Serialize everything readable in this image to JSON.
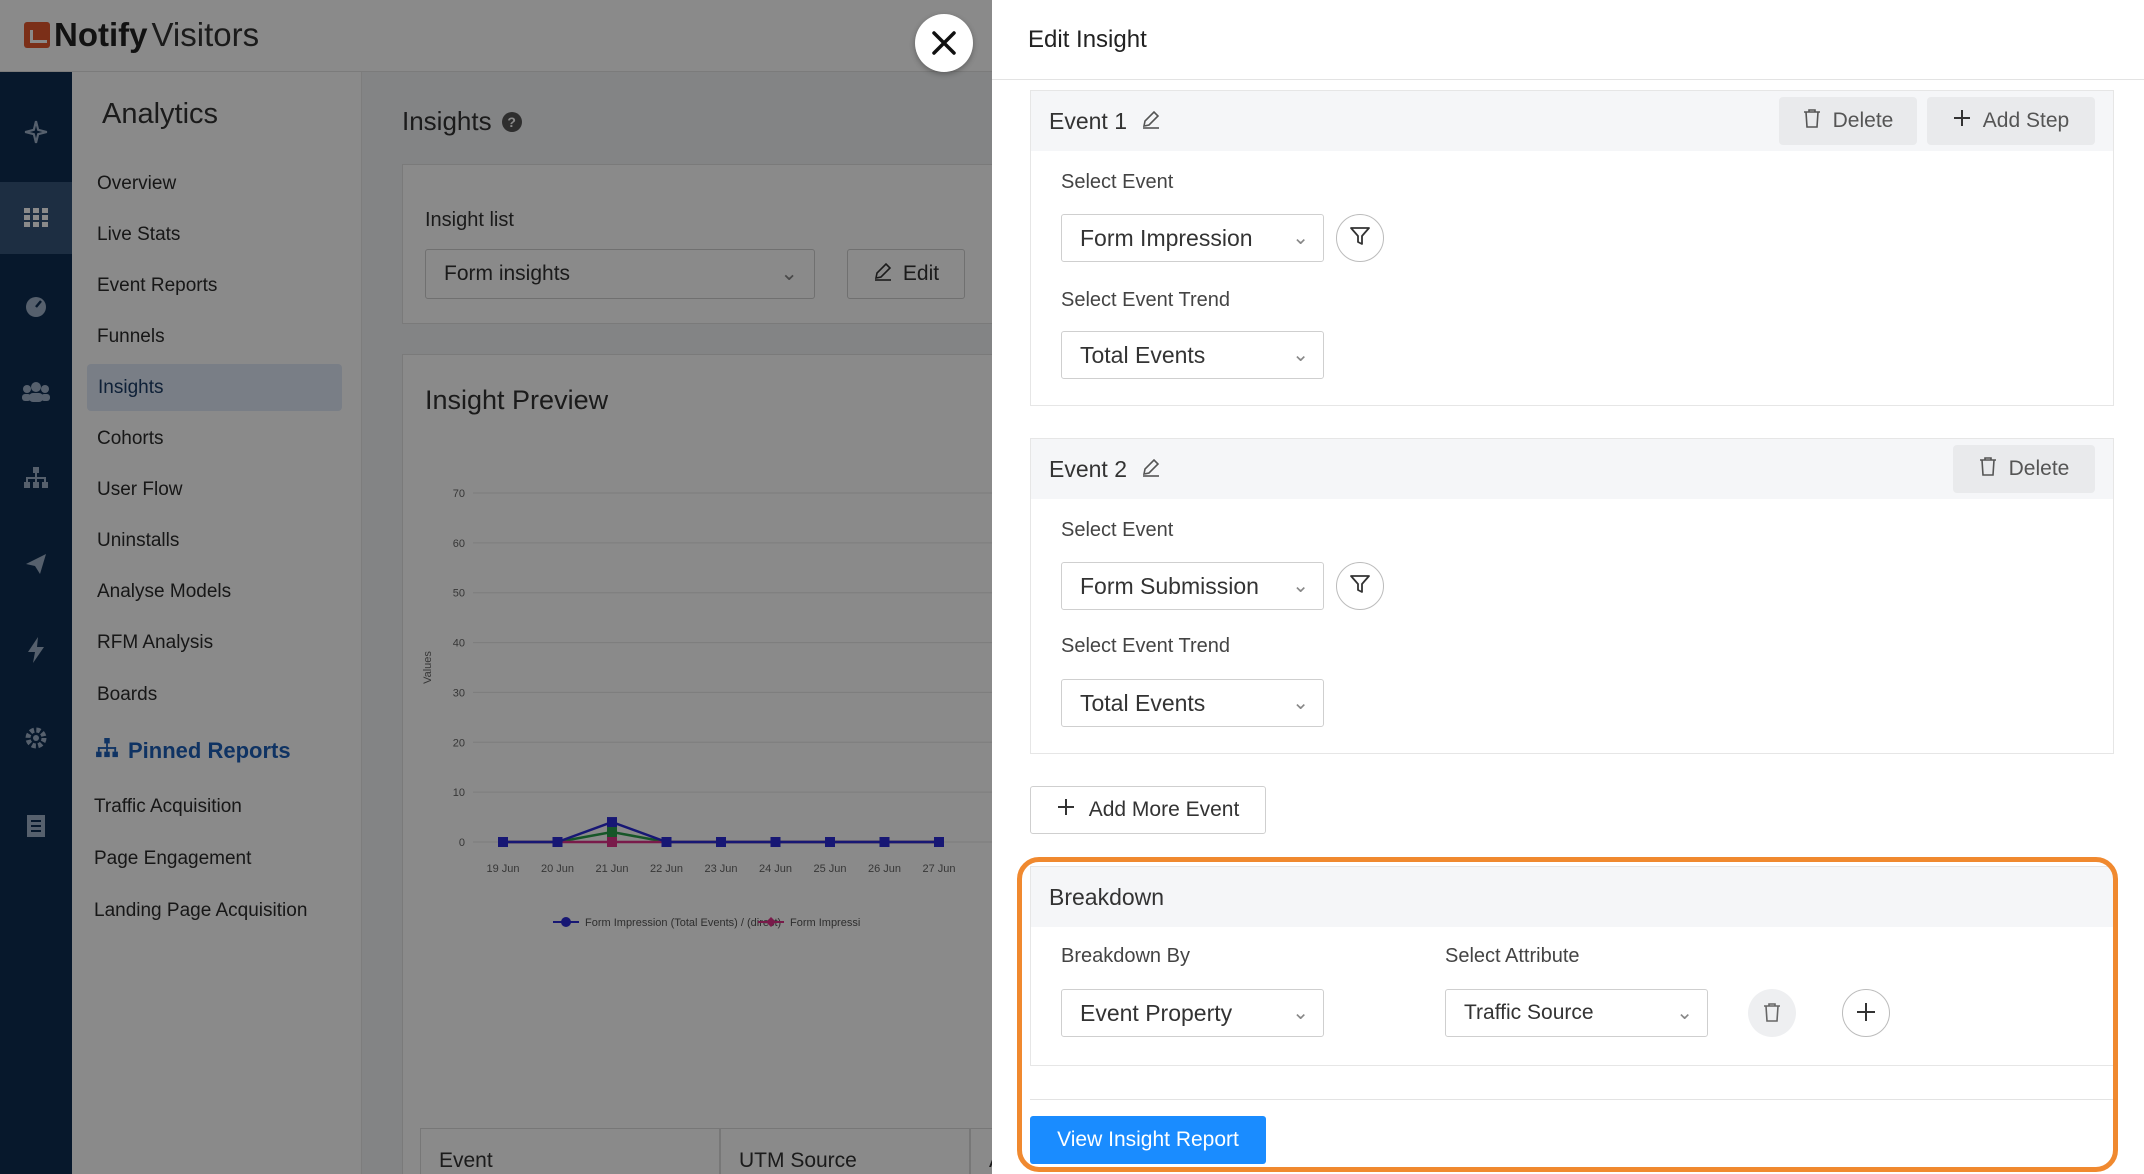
{
  "app": {
    "logo_bold": "Notify",
    "logo_light": "Visitors",
    "nav_title": "Analytics",
    "nav_items": [
      {
        "label": "Overview"
      },
      {
        "label": "Live Stats"
      },
      {
        "label": "Event Reports"
      },
      {
        "label": "Funnels"
      },
      {
        "label": "Insights",
        "active": true
      },
      {
        "label": "Cohorts"
      },
      {
        "label": "User Flow"
      },
      {
        "label": "Uninstalls"
      },
      {
        "label": "Analyse Models"
      },
      {
        "label": "RFM Analysis"
      },
      {
        "label": "Boards"
      }
    ],
    "pinned_title": "Pinned Reports",
    "pinned_items": [
      {
        "label": "Traffic Acquisition"
      },
      {
        "label": "Page Engagement"
      },
      {
        "label": "Landing Page Acquisition"
      }
    ],
    "rail_icons": [
      "sparkle-icon",
      "grid-icon",
      "dashboard-icon",
      "users-icon",
      "sitemap-icon",
      "send-icon",
      "bolt-icon",
      "gear-icon",
      "document-icon"
    ]
  },
  "content": {
    "title": "Insights",
    "insight_list_label": "Insight list",
    "insight_select_value": "Form insights",
    "edit_label": "Edit",
    "preview_title": "Insight Preview",
    "table_headers": [
      "Event",
      "UTM Source",
      "A"
    ]
  },
  "chart_data": {
    "type": "line",
    "ylabel": "Values",
    "ylim": [
      0,
      70
    ],
    "yticks": [
      0,
      10,
      20,
      30,
      40,
      50,
      60,
      70
    ],
    "categories": [
      "19 Jun",
      "20 Jun",
      "21 Jun",
      "22 Jun",
      "23 Jun",
      "24 Jun",
      "25 Jun",
      "26 Jun",
      "27 Jun"
    ],
    "series": [
      {
        "name": "Form Impression (Total Events) / (direct)",
        "color": "#2b2bd6",
        "values": [
          0,
          0,
          4,
          0,
          0,
          0,
          0,
          0,
          0
        ]
      },
      {
        "name": "Form Impressi",
        "color": "#e0338a",
        "values": [
          0,
          0,
          0,
          0,
          0,
          0,
          0,
          0,
          0
        ]
      },
      {
        "color": "#2aa04a",
        "values": [
          0,
          0,
          2,
          0,
          0,
          0,
          0,
          0,
          0
        ]
      }
    ]
  },
  "drawer": {
    "title": "Edit Insight",
    "close_icon": "close-icon",
    "events": [
      {
        "title": "Event 1",
        "delete_label": "Delete",
        "add_step_label": "Add Step",
        "select_event_label": "Select Event",
        "event_value": "Form Impression",
        "trend_label": "Select Event Trend",
        "trend_value": "Total Events"
      },
      {
        "title": "Event 2",
        "delete_label": "Delete",
        "select_event_label": "Select Event",
        "event_value": "Form Submission",
        "trend_label": "Select Event Trend",
        "trend_value": "Total Events"
      }
    ],
    "add_more_label": "Add More Event",
    "breakdown": {
      "title": "Breakdown",
      "by_label": "Breakdown By",
      "by_value": "Event Property",
      "attr_label": "Select Attribute",
      "attr_value": "Traffic Source"
    },
    "view_report_label": "View Insight Report",
    "highlight_color": "#f0892f",
    "primary_color": "#1a8cff"
  }
}
